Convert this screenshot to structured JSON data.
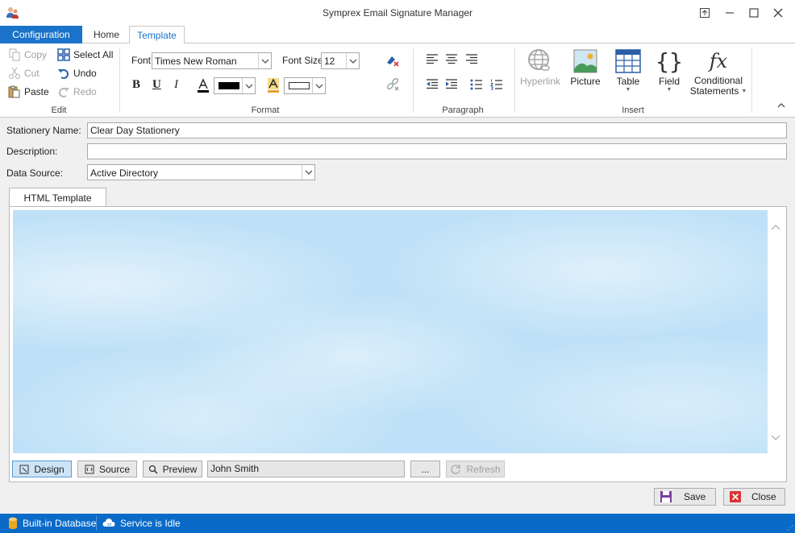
{
  "window": {
    "title": "Symprex Email Signature Manager"
  },
  "tabs": {
    "configuration": "Configuration",
    "home": "Home",
    "template": "Template"
  },
  "ribbon": {
    "edit": {
      "copy": "Copy",
      "cut": "Cut",
      "paste": "Paste",
      "select_all": "Select All",
      "undo": "Undo",
      "redo": "Redo",
      "label": "Edit"
    },
    "format": {
      "font_label": "Font",
      "font_value": "Times New Roman",
      "font_size_label": "Font Size",
      "font_size_value": "12",
      "bold": "B",
      "underline": "U",
      "italic": "I",
      "font_color": "#000000",
      "label": "Format"
    },
    "paragraph": {
      "label": "Paragraph"
    },
    "insert": {
      "hyperlink": "Hyperlink",
      "picture": "Picture",
      "table": "Table",
      "field": "Field",
      "conditional_1": "Conditional",
      "conditional_2": "Statements",
      "label": "Insert"
    }
  },
  "form": {
    "stationery_name_label": "Stationery Name:",
    "stationery_name_value": "Clear Day Stationery",
    "description_label": "Description:",
    "description_value": "",
    "data_source_label": "Data Source:",
    "data_source_value": "Active Directory"
  },
  "template": {
    "tab_label": "HTML Template",
    "design": "Design",
    "source": "Source",
    "preview": "Preview",
    "preview_user": "John Smith",
    "browse": "...",
    "refresh": "Refresh"
  },
  "footer": {
    "save": "Save",
    "close": "Close"
  },
  "status": {
    "database": "Built-in Database",
    "service": "Service is Idle"
  },
  "colors": {
    "accent": "#1a73c8",
    "status_bar": "#0a6ac8",
    "canvas": "#bfe1f7"
  }
}
